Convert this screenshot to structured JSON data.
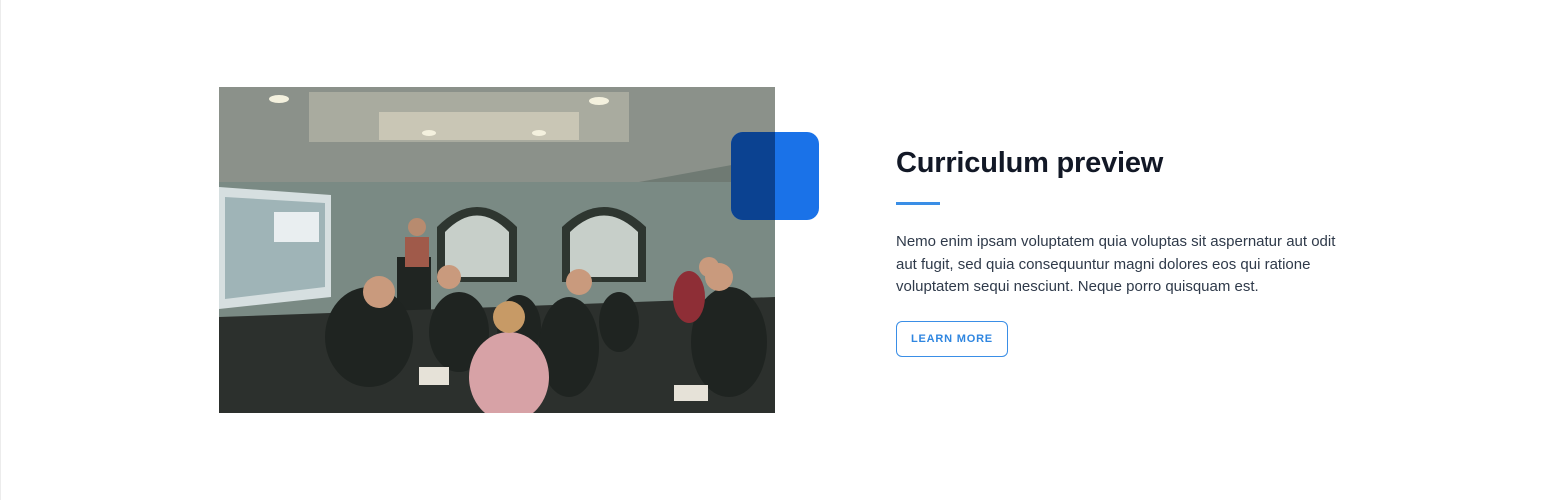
{
  "feature": {
    "title": "Curriculum preview",
    "description": "Nemo enim ipsam voluptatem quia voluptas sit aspernatur aut odit aut fugit, sed quia consequuntur magni dolores eos qui ratione voluptatem sequi nesciunt. Neque porro quisquam est.",
    "cta_label": "LEARN MORE",
    "image_alt": "classroom presentation photo"
  },
  "colors": {
    "accent": "#1a72e8",
    "accent_dark": "#0b3f8c",
    "link": "#3a8ee6",
    "heading": "#121826",
    "text": "#2f3a4a"
  }
}
